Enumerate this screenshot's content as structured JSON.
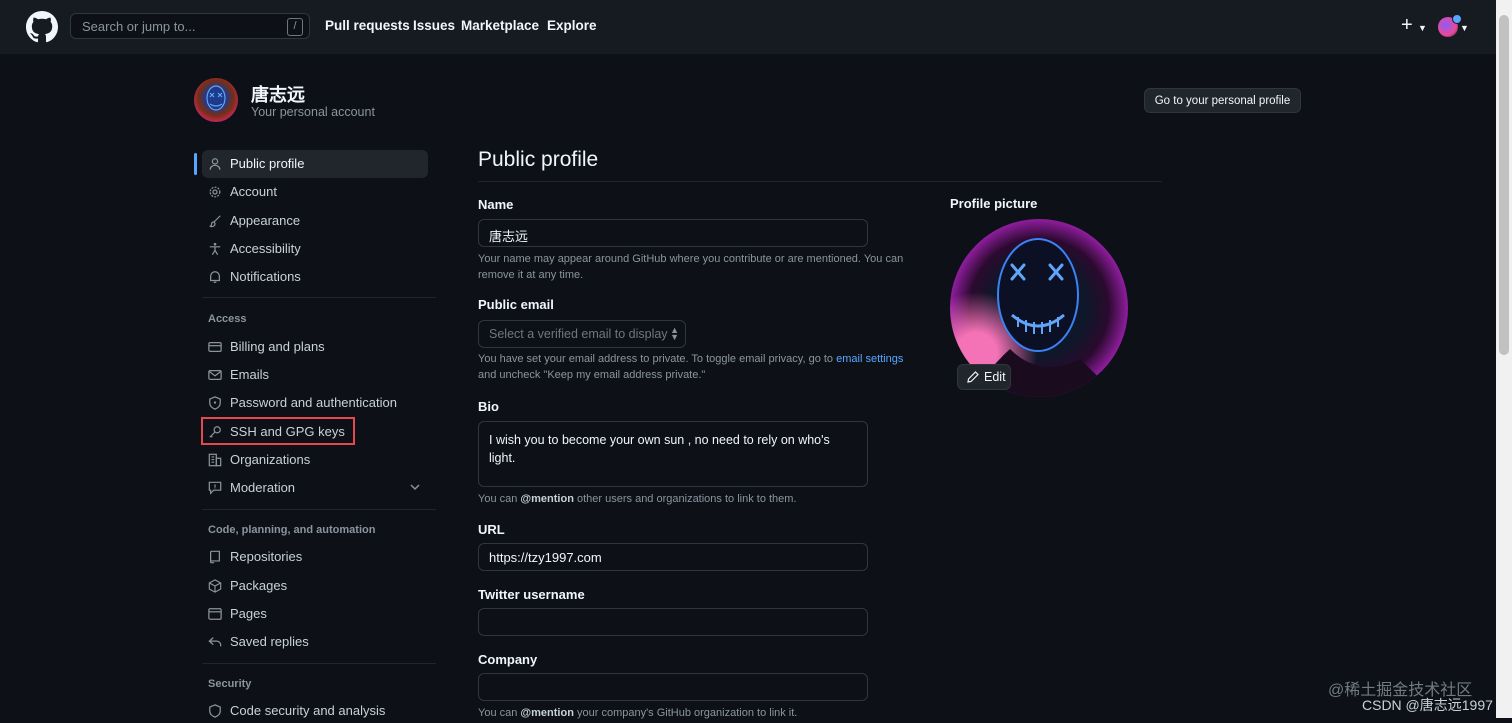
{
  "header": {
    "search_placeholder": "Search or jump to...",
    "search_shortcut": "/",
    "nav": [
      "Pull requests",
      "Issues",
      "Marketplace",
      "Explore"
    ],
    "plus": "+"
  },
  "account": {
    "name": "唐志远",
    "subtitle": "Your personal account",
    "goto_profile": "Go to your personal profile"
  },
  "sidebar": {
    "items": [
      {
        "label": "Public profile",
        "icon": "person-icon"
      },
      {
        "label": "Account",
        "icon": "gear-icon"
      },
      {
        "label": "Appearance",
        "icon": "paintbrush-icon"
      },
      {
        "label": "Accessibility",
        "icon": "accessibility-icon"
      },
      {
        "label": "Notifications",
        "icon": "bell-icon"
      }
    ],
    "access_heading": "Access",
    "access_items": [
      {
        "label": "Billing and plans",
        "icon": "credit-card-icon"
      },
      {
        "label": "Emails",
        "icon": "mail-icon"
      },
      {
        "label": "Password and authentication",
        "icon": "shield-lock-icon"
      },
      {
        "label": "SSH and GPG keys",
        "icon": "key-icon"
      },
      {
        "label": "Organizations",
        "icon": "organization-icon"
      },
      {
        "label": "Moderation",
        "icon": "report-icon"
      }
    ],
    "code_heading": "Code, planning, and automation",
    "code_items": [
      {
        "label": "Repositories",
        "icon": "repo-icon"
      },
      {
        "label": "Packages",
        "icon": "package-icon"
      },
      {
        "label": "Pages",
        "icon": "browser-icon"
      },
      {
        "label": "Saved replies",
        "icon": "reply-icon"
      }
    ],
    "security_heading": "Security",
    "security_items": [
      {
        "label": "Code security and analysis",
        "icon": "shield-icon"
      }
    ]
  },
  "main": {
    "title": "Public profile",
    "name_label": "Name",
    "name_value": "唐志远",
    "name_note": "Your name may appear around GitHub where you contribute or are mentioned. You can remove it at any time.",
    "email_label": "Public email",
    "email_placeholder": "Select a verified email to display",
    "email_note_1": "You have set your email address to private. To toggle email privacy, go to ",
    "email_note_link": "email settings",
    "email_note_2": " and uncheck \"Keep my email address private.\"",
    "bio_label": "Bio",
    "bio_value": "I wish you to become your own sun , no need to rely on who's light.",
    "bio_note_1": "You can ",
    "bio_note_mention": "@mention",
    "bio_note_2": " other users and organizations to link to them.",
    "url_label": "URL",
    "url_value": "https://tzy1997.com",
    "twitter_label": "Twitter username",
    "twitter_value": "",
    "company_label": "Company",
    "company_value": "",
    "company_note_1": "You can ",
    "company_note_mention": "@mention",
    "company_note_2": " your company's GitHub organization to link it."
  },
  "profile_picture": {
    "label": "Profile picture",
    "edit": "Edit"
  },
  "watermark": {
    "line1": "@稀土掘金技术社区",
    "line2": "CSDN @唐志远1997"
  },
  "colors": {
    "background": "#0d1117",
    "header": "#161b22",
    "accent": "#58a6ff",
    "highlight": "#e5484d"
  }
}
